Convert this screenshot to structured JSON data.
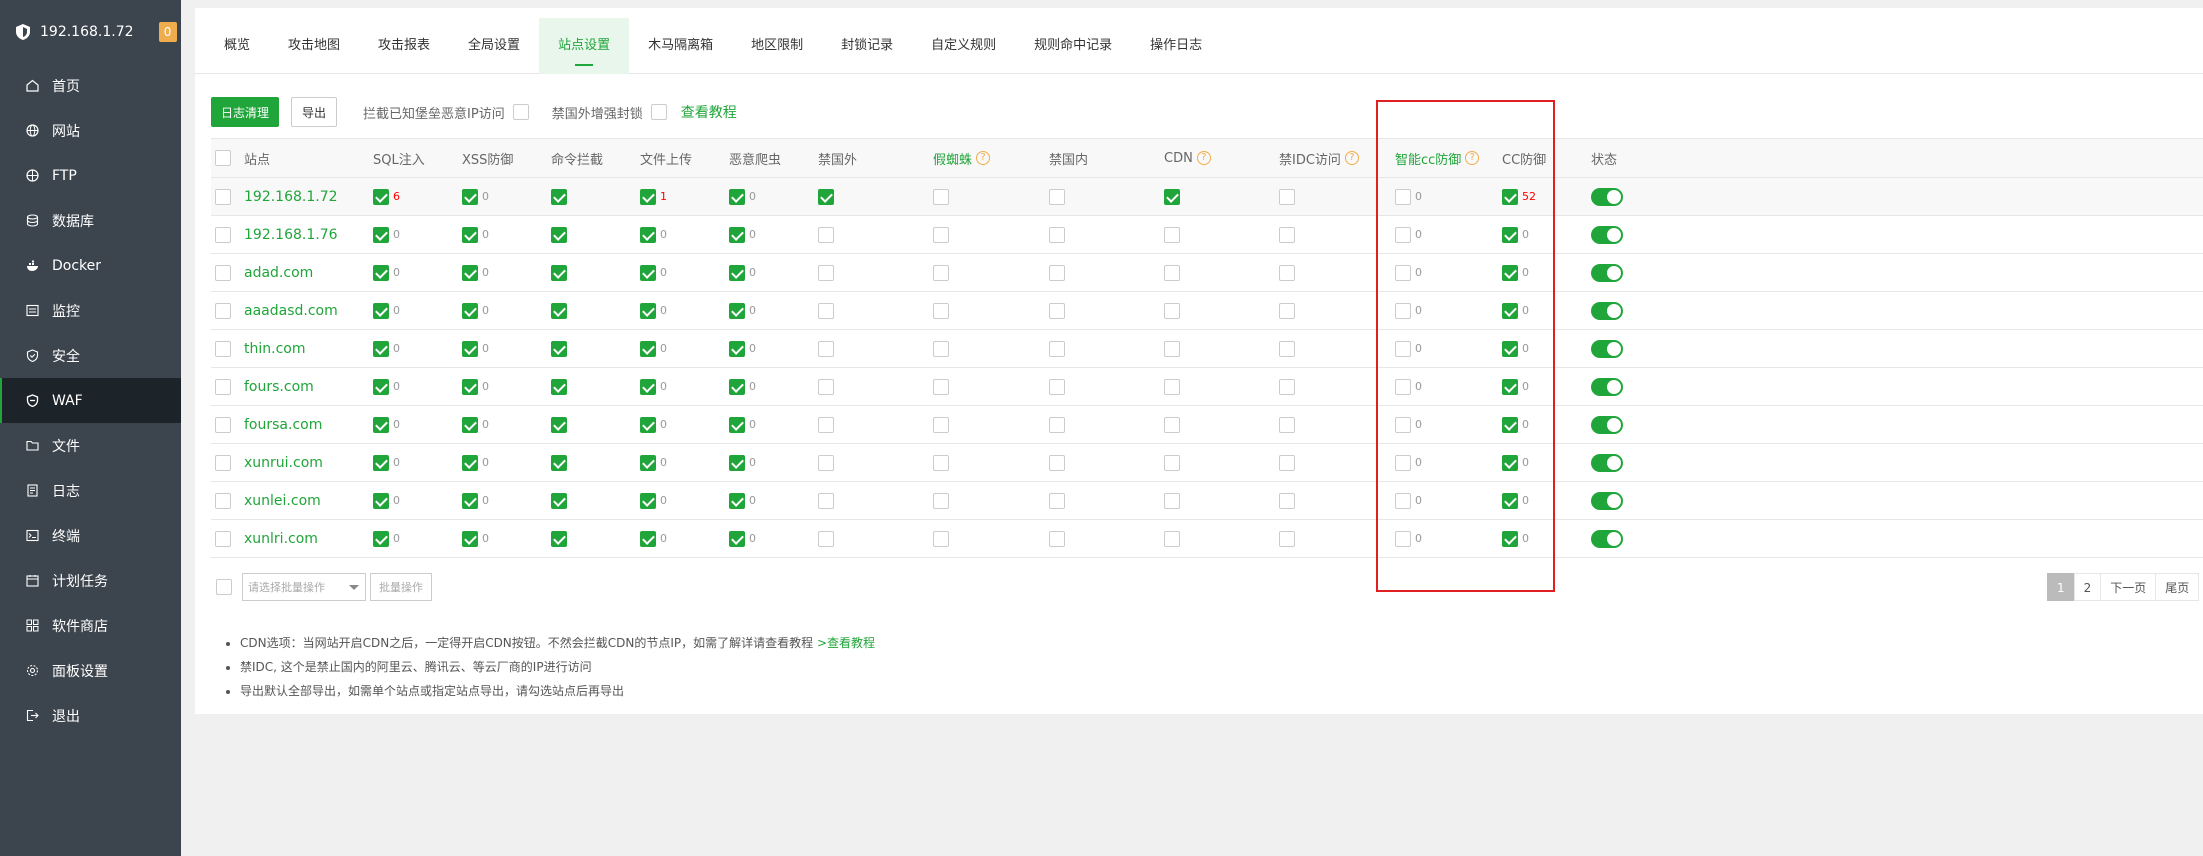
{
  "sidebar": {
    "host": "192.168.1.72",
    "badge": "0",
    "items": [
      {
        "label": "首页",
        "icon": "home-icon"
      },
      {
        "label": "网站",
        "icon": "globe-icon"
      },
      {
        "label": "FTP",
        "icon": "ftp-globe-icon"
      },
      {
        "label": "数据库",
        "icon": "database-icon"
      },
      {
        "label": "Docker",
        "icon": "docker-icon"
      },
      {
        "label": "监控",
        "icon": "monitor-icon"
      },
      {
        "label": "安全",
        "icon": "security-shield-icon"
      },
      {
        "label": "WAF",
        "icon": "waf-shield-icon"
      },
      {
        "label": "文件",
        "icon": "folder-icon"
      },
      {
        "label": "日志",
        "icon": "log-icon"
      },
      {
        "label": "终端",
        "icon": "terminal-icon"
      },
      {
        "label": "计划任务",
        "icon": "calendar-icon"
      },
      {
        "label": "软件商店",
        "icon": "apps-icon"
      },
      {
        "label": "面板设置",
        "icon": "gear-icon"
      },
      {
        "label": "退出",
        "icon": "logout-icon"
      }
    ]
  },
  "tabs": [
    "概览",
    "攻击地图",
    "攻击报表",
    "全局设置",
    "站点设置",
    "木马隔离箱",
    "地区限制",
    "封锁记录",
    "自定义规则",
    "规则命中记录",
    "操作日志"
  ],
  "toolbar": {
    "clear_log": "日志清理",
    "export": "导出",
    "block_label": "拦截已知堡垒恶意IP访问",
    "foreign_label": "禁国外增强封锁",
    "tutorial": "查看教程"
  },
  "columns": [
    "站点",
    "SQL注入",
    "XSS防御",
    "命令拦截",
    "文件上传",
    "恶意爬虫",
    "禁国外",
    "假蜘蛛",
    "禁国内",
    "CDN",
    "禁IDC访问",
    "智能cc防御",
    "CC防御",
    "状态"
  ],
  "rows": [
    {
      "site": "192.168.1.72",
      "sql": "6",
      "xss": "0",
      "upload": "1",
      "crawler": "0",
      "foreign": true,
      "cdn": true,
      "smartcc": "0",
      "cc": "52"
    },
    {
      "site": "192.168.1.76",
      "sql": "0",
      "xss": "0",
      "upload": "0",
      "crawler": "0",
      "foreign": false,
      "cdn": false,
      "smartcc": "0",
      "cc": "0"
    },
    {
      "site": "adad.com",
      "sql": "0",
      "xss": "0",
      "upload": "0",
      "crawler": "0",
      "foreign": false,
      "cdn": false,
      "smartcc": "0",
      "cc": "0"
    },
    {
      "site": "aaadasd.com",
      "sql": "0",
      "xss": "0",
      "upload": "0",
      "crawler": "0",
      "foreign": false,
      "cdn": false,
      "smartcc": "0",
      "cc": "0"
    },
    {
      "site": "thin.com",
      "sql": "0",
      "xss": "0",
      "upload": "0",
      "crawler": "0",
      "foreign": false,
      "cdn": false,
      "smartcc": "0",
      "cc": "0"
    },
    {
      "site": "fours.com",
      "sql": "0",
      "xss": "0",
      "upload": "0",
      "crawler": "0",
      "foreign": false,
      "cdn": false,
      "smartcc": "0",
      "cc": "0"
    },
    {
      "site": "foursa.com",
      "sql": "0",
      "xss": "0",
      "upload": "0",
      "crawler": "0",
      "foreign": false,
      "cdn": false,
      "smartcc": "0",
      "cc": "0"
    },
    {
      "site": "xunrui.com",
      "sql": "0",
      "xss": "0",
      "upload": "0",
      "crawler": "0",
      "foreign": false,
      "cdn": false,
      "smartcc": "0",
      "cc": "0"
    },
    {
      "site": "xunlei.com",
      "sql": "0",
      "xss": "0",
      "upload": "0",
      "crawler": "0",
      "foreign": false,
      "cdn": false,
      "smartcc": "0",
      "cc": "0"
    },
    {
      "site": "xunlri.com",
      "sql": "0",
      "xss": "0",
      "upload": "0",
      "crawler": "0",
      "foreign": false,
      "cdn": false,
      "smartcc": "0",
      "cc": "0"
    }
  ],
  "batch": {
    "placeholder": "请选择批量操作",
    "button": "批量操作"
  },
  "pager": [
    "1",
    "2",
    "下一页",
    "尾页"
  ],
  "notes": [
    {
      "text": "CDN选项：当网站开启CDN之后，一定得开启CDN按钮。不然会拦截CDN的节点IP，如需了解详请查看教程 ",
      "link": ">查看教程"
    },
    {
      "text": "禁IDC, 这个是禁止国内的阿里云、腾讯云、等云厂商的IP进行访问",
      "link": ""
    },
    {
      "text": "导出默认全部导出，如需单个站点或指定站点导出，请勾选站点后再导出",
      "link": ""
    }
  ],
  "colors": {
    "accent": "#20a53a",
    "sidebar": "#3c444d",
    "highlight": "#e02020",
    "help": "#f0ad4e"
  }
}
